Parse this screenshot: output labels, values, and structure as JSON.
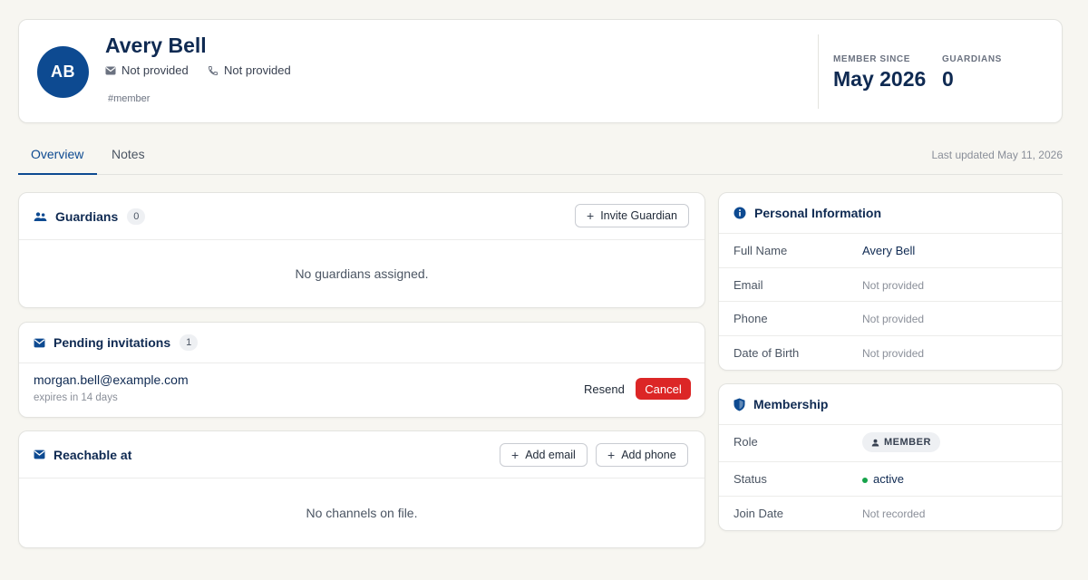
{
  "profile": {
    "initials": "AB",
    "name": "Avery Bell",
    "email": "Not provided",
    "phone": "Not provided",
    "tag": "#member",
    "stats": [
      {
        "label": "MEMBER SINCE",
        "value": "May 2026"
      },
      {
        "label": "GUARDIANS",
        "value": "0"
      }
    ]
  },
  "tabs": [
    {
      "label": "Overview",
      "active": true
    },
    {
      "label": "Notes",
      "active": false
    }
  ],
  "last_updated": "Last updated May 11, 2026",
  "guardians": {
    "title": "Guardians",
    "count": "0",
    "invite_label": "Invite Guardian",
    "empty": "No guardians assigned."
  },
  "pending": {
    "title": "Pending invitations",
    "count": "1",
    "items": [
      {
        "email": "morgan.bell@example.com",
        "expires": "expires in 14 days",
        "resend_label": "Resend",
        "cancel_label": "Cancel"
      }
    ]
  },
  "reachable": {
    "title": "Reachable at",
    "add_email_label": "Add email",
    "add_phone_label": "Add phone",
    "empty": "No channels on file."
  },
  "personal": {
    "title": "Personal Information",
    "rows": [
      {
        "label": "Full Name",
        "value": "Avery Bell"
      },
      {
        "label": "Email",
        "value": "Not provided"
      },
      {
        "label": "Phone",
        "value": "Not provided"
      },
      {
        "label": "Date of Birth",
        "value": "Not provided"
      }
    ]
  },
  "membership": {
    "title": "Membership",
    "rows": [
      {
        "label": "Role",
        "value": "MEMBER"
      },
      {
        "label": "Status",
        "value": "active"
      },
      {
        "label": "Join Date",
        "value": "Not recorded"
      }
    ]
  },
  "colors": {
    "brand": "#0d4a91",
    "danger": "#dc2626",
    "success": "#16a34a",
    "background": "#f7f6f1"
  },
  "icons": [
    "mail-icon",
    "phone-icon",
    "users-icon",
    "plus-icon",
    "info-icon",
    "shield-icon",
    "user-icon"
  ]
}
